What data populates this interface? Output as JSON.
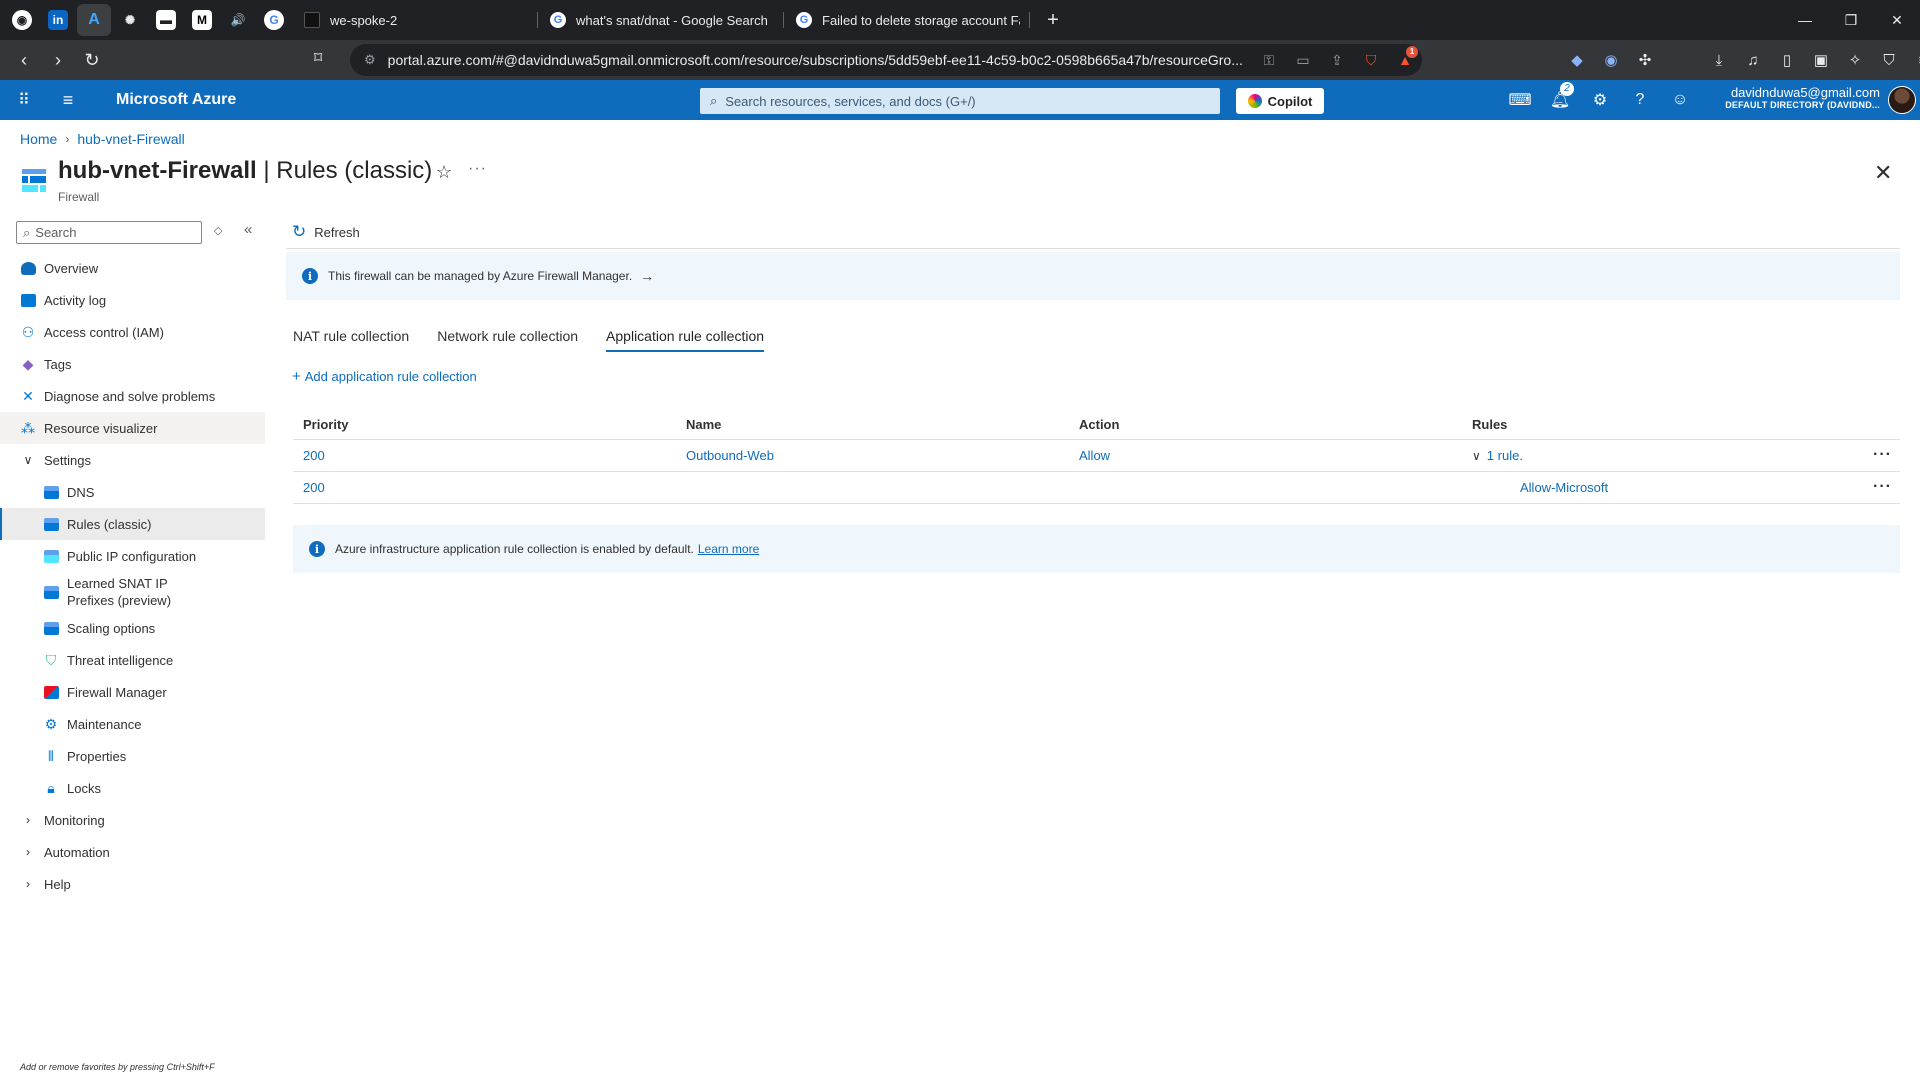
{
  "browser": {
    "pinned_tabs": [
      {
        "icon": "github-icon",
        "glyph": "◉"
      },
      {
        "icon": "linkedin-icon",
        "glyph": "in"
      },
      {
        "icon": "azure-icon",
        "glyph": "A"
      },
      {
        "icon": "chatgpt-icon",
        "glyph": "✺"
      },
      {
        "icon": "notion-icon",
        "glyph": "▬"
      },
      {
        "icon": "medium-icon",
        "glyph": "M"
      },
      {
        "icon": "audio-icon",
        "glyph": "🔊"
      },
      {
        "icon": "google-icon",
        "glyph": "G"
      }
    ],
    "tabs": [
      {
        "title": "we-spoke-2",
        "favicon": "terminal-icon"
      },
      {
        "title": "what's snat/dnat - Google Search",
        "favicon": "google-icon"
      },
      {
        "title": "Failed to delete storage account Faile",
        "favicon": "google-icon"
      }
    ],
    "new_tab_label": "+",
    "url": "portal.azure.com/#@davidnduwa5gmail.onmicrosoft.com/resource/subscriptions/5dd59ebf-ee11-4c59-b0c2-0598b665a47b/resourceGro...",
    "brave_badge": "1"
  },
  "azure": {
    "brand": "Microsoft Azure",
    "search_placeholder": "Search resources, services, and docs (G+/)",
    "copilot_label": "Copilot",
    "notification_count": "2",
    "account_email": "davidnduwa5@gmail.com",
    "account_directory": "DEFAULT DIRECTORY (DAVIDND..."
  },
  "breadcrumb": {
    "home": "Home",
    "resource": "hub-vnet-Firewall"
  },
  "header": {
    "resource_name": "hub-vnet-Firewall",
    "blade_name": " | Rules (classic)",
    "resource_type": "Firewall"
  },
  "nav": {
    "search_placeholder": "Search",
    "items": [
      {
        "label": "Overview"
      },
      {
        "label": "Activity log"
      },
      {
        "label": "Access control (IAM)"
      },
      {
        "label": "Tags"
      },
      {
        "label": "Diagnose and solve problems"
      },
      {
        "label": "Resource visualizer"
      },
      {
        "label": "Settings"
      },
      {
        "label": "DNS"
      },
      {
        "label": "Rules (classic)"
      },
      {
        "label": "Public IP configuration"
      },
      {
        "label": "Learned SNAT IP Prefixes (preview)"
      },
      {
        "label": "Scaling options"
      },
      {
        "label": "Threat intelligence"
      },
      {
        "label": "Firewall Manager"
      },
      {
        "label": "Maintenance"
      },
      {
        "label": "Properties"
      },
      {
        "label": "Locks"
      },
      {
        "label": "Monitoring"
      },
      {
        "label": "Automation"
      },
      {
        "label": "Help"
      }
    ],
    "favorites_hint": "Add or remove favorites by pressing Ctrl+Shift+F"
  },
  "main": {
    "refresh_label": "Refresh",
    "info_banner": "This firewall can be managed by Azure Firewall Manager.",
    "tabs": [
      {
        "label": "NAT rule collection"
      },
      {
        "label": "Network rule collection"
      },
      {
        "label": "Application rule collection"
      }
    ],
    "add_label": "Add application rule collection",
    "table": {
      "columns": [
        "Priority",
        "Name",
        "Action",
        "Rules"
      ],
      "rows": [
        {
          "priority": "200",
          "name": "Outbound-Web",
          "action": "Allow",
          "rules": "1 rule."
        },
        {
          "priority": "200",
          "name": "",
          "action": "",
          "rules": "Allow-Microsoft"
        }
      ]
    },
    "infra_banner": "Azure infrastructure application rule collection is enabled by default.",
    "learn_more": "Learn more"
  },
  "colors": {
    "azure_blue": "#0f6cbd",
    "link": "#0f6cbd",
    "banner_bg": "#eff6fc"
  }
}
